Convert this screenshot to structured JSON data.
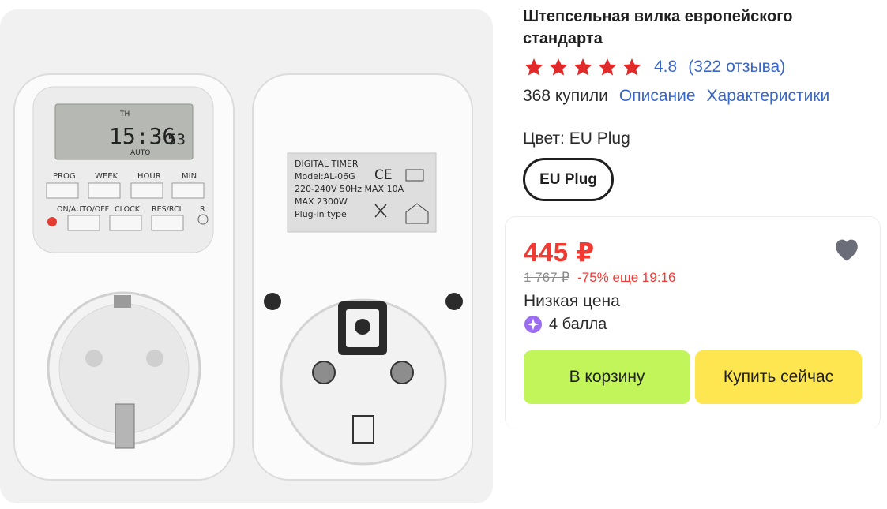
{
  "product": {
    "title": "Штепсельная вилка европейского стандарта",
    "rating": "4.8",
    "reviews": "(322 отзыва)",
    "bought": "368 купили",
    "links": {
      "description": "Описание",
      "specs": "Характеристики"
    },
    "color_label": "Цвет: EU Plug",
    "variants": [
      "EU Plug"
    ],
    "stars": 5
  },
  "image": {
    "lcd": {
      "day": "TH",
      "time": "15:36",
      "seconds": "53",
      "mode": "AUTO"
    },
    "buttons_row1": [
      "PROG",
      "WEEK",
      "HOUR",
      "MIN"
    ],
    "buttons_row2": [
      "ON/AUTO/OFF",
      "CLOCK",
      "RES/RCL",
      "R"
    ],
    "label_lines": [
      "DIGITAL TIMER",
      "Model:AL-06G",
      "220-240V 50Hz  MAX 10A",
      "MAX 2300W",
      "Plug-in type"
    ],
    "label_mark": "CE"
  },
  "offer": {
    "price": "445 ₽",
    "old_price": "1 767 ₽",
    "discount": "-75% еще 19:16",
    "low_price": "Низкая цена",
    "points": "4 балла",
    "add_to_cart": "В корзину",
    "buy_now": "Купить сейчас"
  },
  "colors": {
    "accent_red": "#f23a32",
    "link_blue": "#3967c9",
    "star_red": "#e02a2a",
    "cart_green": "#c2f55a",
    "buy_yellow": "#fde64f",
    "heart_gray": "#6b6e78",
    "points_purple": "#9b6cf0"
  },
  "icons": [
    "star-icon",
    "heart-icon",
    "points-icon"
  ]
}
